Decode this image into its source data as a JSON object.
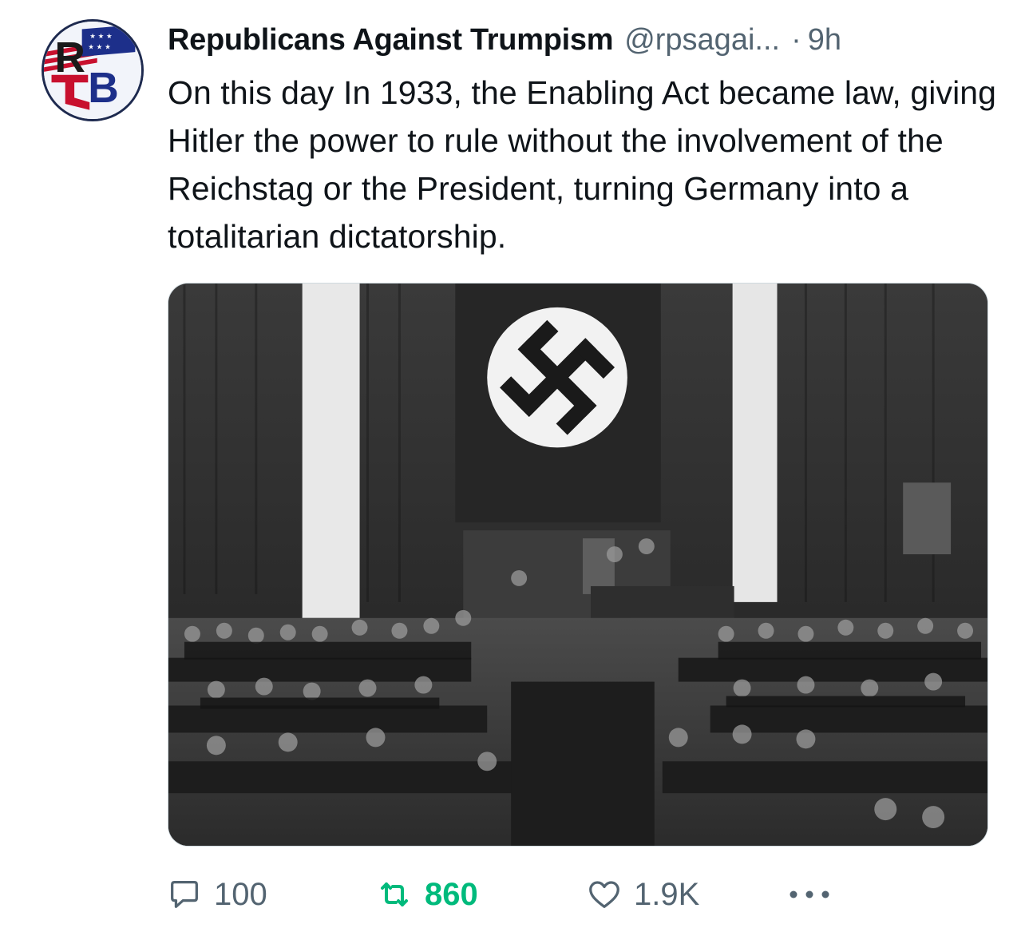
{
  "tweet": {
    "author": {
      "display_name": "Republicans Against Trumpism",
      "handle": "@rpsagai...",
      "separator": "·",
      "time": "9h",
      "avatar_icon": "rb-logo-icon",
      "avatar_letters": "RB"
    },
    "text": "On this day In 1933, the Enabling Act became law, giving Hitler the power to rule without the involvement of the Reichstag or the President, turning Germany into a totalitarian dictatorship.",
    "media": {
      "type": "black-and-white photograph",
      "icon": "photo-icon"
    },
    "actions": {
      "reply": {
        "icon": "reply-icon",
        "count": "100"
      },
      "retweet": {
        "icon": "retweet-icon",
        "count": "860",
        "active": true
      },
      "like": {
        "icon": "heart-icon",
        "count": "1.9K"
      },
      "more": {
        "icon": "more-icon"
      }
    }
  },
  "colors": {
    "text_primary": "#0f1419",
    "text_secondary": "#536471",
    "retweet_green": "#00ba7c"
  }
}
